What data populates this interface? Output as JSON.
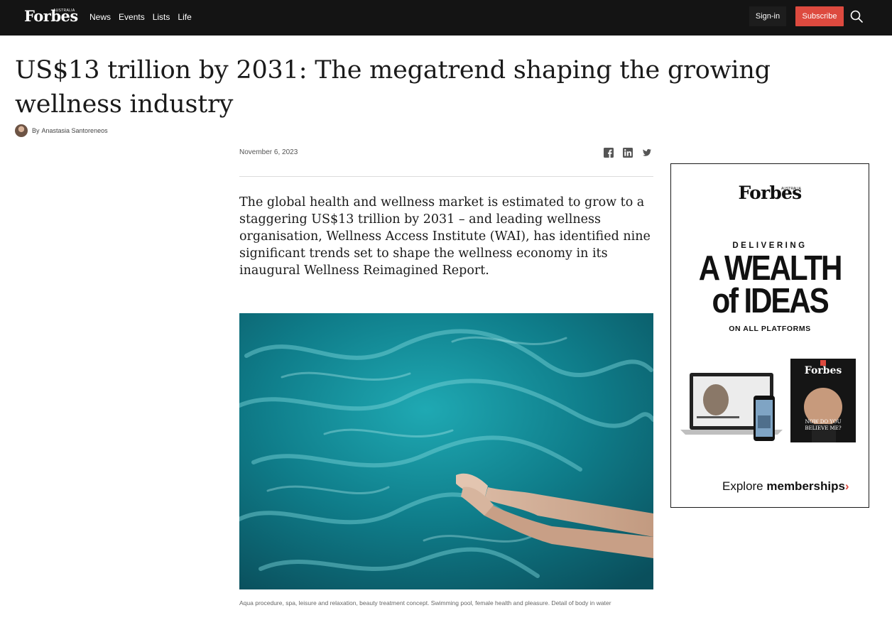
{
  "nav": {
    "logo": "Forbes",
    "logo_sup": "AUSTRALIA",
    "links": [
      "News",
      "Events",
      "Lists",
      "Life"
    ],
    "signin_label": "Sign-in",
    "subscribe_label": "Subscribe",
    "search_icon": "search-icon"
  },
  "article": {
    "headline": "US$13 trillion by 2031: The megatrend shaping the growing wellness industry",
    "byline_prefix": "By",
    "author": "Anastasia Santoreneos",
    "date": "November 6, 2023",
    "share_icons": [
      "facebook-icon",
      "linkedin-icon",
      "twitter-icon"
    ],
    "lede": "The global health and wellness market is estimated to grow to a staggering US$13 trillion by 2031 – and leading wellness organisation, Wellness Access Institute (WAI), has identified nine significant trends set to shape the wellness economy in its inaugural Wellness Reimagined Report.",
    "caption": "Aqua procedure, spa, leisure and relaxation, beauty treatment concept. Swimming pool, female health and pleasure. Detail of body in water"
  },
  "ad": {
    "logo": "Forbes",
    "logo_sup": "AUSTRALIA",
    "kicker": "DELIVERING",
    "headline_line1": "A WEALTH",
    "headline_line2": "of IDEAS",
    "subline": "ON ALL PLATFORMS",
    "mag_title": "Forbes",
    "mag_cover_line1": "NOW DO YOU",
    "mag_cover_line2": "BELIEVE ME?",
    "cta_prefix": "Explore",
    "cta_bold": "memberships",
    "cta_chevron": "›"
  },
  "colors": {
    "nav_bg": "#141414",
    "subscribe_bg": "#dd4a3f",
    "accent": "#dd4a3f"
  }
}
